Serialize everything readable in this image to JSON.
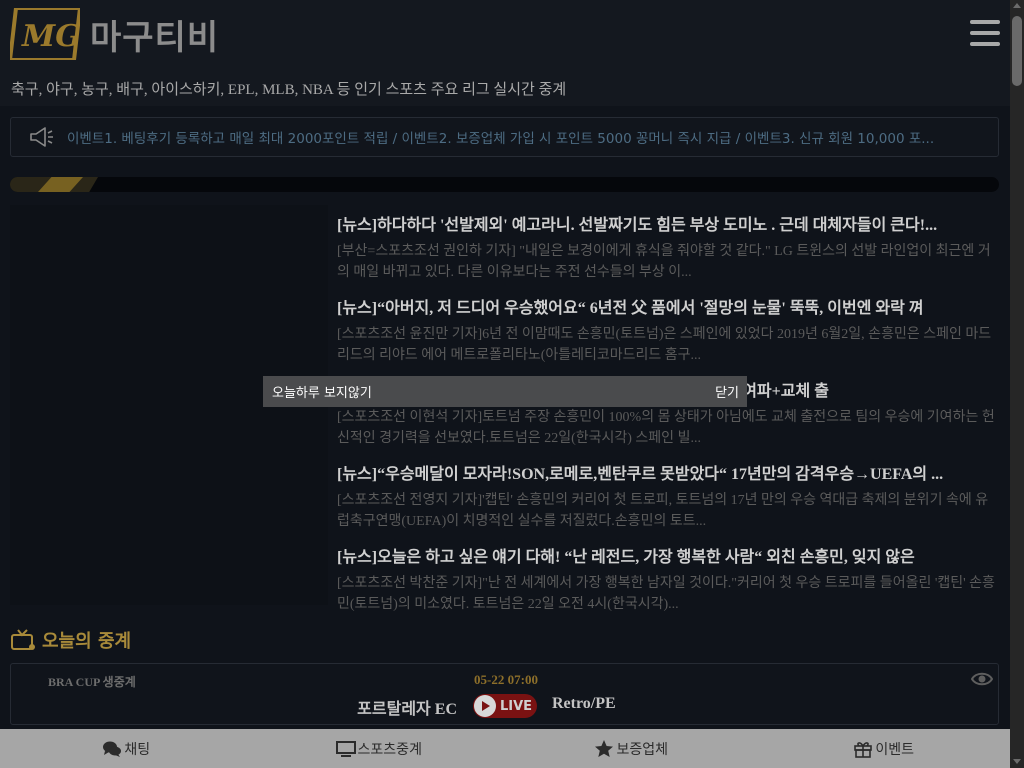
{
  "header": {
    "logo_text": "마구티비",
    "logo_mark": "MG",
    "tagline": "축구, 야구, 농구, 배구, 아이스하키, EPL, MLB, NBA 등 인기 스포츠 주요 리그 실시간 중계"
  },
  "notice": {
    "icon": "megaphone-icon",
    "text": "이벤트1. 베팅후기 등록하고 매일 최대 2000포인트 적립 / 이벤트2. 보증업체 가입 시 포인트 5000 꽁머니 즉시 지급 / 이벤트3. 신규 회원 10,000 포..."
  },
  "news": [
    {
      "title": "[뉴스]하다하다 '선발제외' 예고라니. 선발짜기도 힘든 부상 도미노 . 근데 대체자들이 큰다!...",
      "desc": "[부산=스포츠조선 권인하 기자] \"내일은 보경이에게 휴식을 줘야할 것 같다.\" LG 트윈스의 선발 라인업이 최근엔 거의 매일 바뀌고 있다. 다른 이유보다는 주전 선수들의 부상 이..."
    },
    {
      "title": "[뉴스]“아버지, 저 드디어 우승했어요“ 6년전 父 품에서 '절망의 눈물' 뚝뚝, 이번엔 와락 껴",
      "desc": "[스포츠조선 윤진만 기자]6년 전 이맘때도 손흥민(토트넘)은 스페인에 있었다 2019년 6월2일, 손흥민은 스페인 마드리드의 리야드 에어 메트로폴리타노(아틀레티코마드리드 홈구..."
    },
    {
      "title": "[뉴스]손흥민 부상 몸 상태로 우승 견인... 아쉬운 경기력? 부상 여파+교체 출",
      "desc": "[스포츠조선 이현석 기자]토트넘 주장 손흥민이 100%의 몸 상태가 아님에도 교체 출전으로 팀의 우승에 기여하는 헌신적인 경기력을 선보였다.토트넘은 22일(한국시각) 스페인 빌..."
    },
    {
      "title": "[뉴스]“우승메달이 모자라!SON,로메로,벤탄쿠르 못받았다“ 17년만의 감격우승→UEFA의 ...",
      "desc": "[스포츠조선 전영지 기자]'캡틴' 손흥민의 커리어 첫 트로피, 토트넘의 17년 만의 우승 역대급 축제의 분위기 속에 유럽축구연맹(UEFA)이 치명적인 실수를 저질렀다.손흥민의 토트..."
    },
    {
      "title": "[뉴스]오늘은 하고 싶은 얘기 다해! “난 레전드, 가장 행복한 사람“ 외친 손흥민, 잊지 않은",
      "desc": "[스포츠조선 박찬준 기자]\"난 전 세계에서 가장 행복한 남자일 것이다.\"커리어 첫 우승 트로피를 들어올린 '캡틴' 손흥민(토트넘)의 미소였다. 토트넘은 22일 오전 4시(한국시각)..."
    }
  ],
  "popup": {
    "hide_today": "오늘하루 보지않기",
    "close": "닫기"
  },
  "today": {
    "title": "오늘의 중계",
    "match": {
      "league": "BRA CUP 생중계",
      "time": "05-22 07:00",
      "home": "포르탈레자 EC",
      "live": "LIVE",
      "away": "Retro/PE"
    }
  },
  "bottom_nav": [
    {
      "label": "채팅",
      "icon": "chat-icon"
    },
    {
      "label": "스포츠중계",
      "icon": "monitor-icon"
    },
    {
      "label": "보증업체",
      "icon": "star-icon"
    },
    {
      "label": "이벤트",
      "icon": "gift-icon"
    }
  ],
  "colors": {
    "background": "#0f131a",
    "accent_gold": "#a88a3a",
    "live_red": "#7a1212",
    "bottom_nav": "#a6a6a6",
    "popup": "#4a4b4d"
  }
}
